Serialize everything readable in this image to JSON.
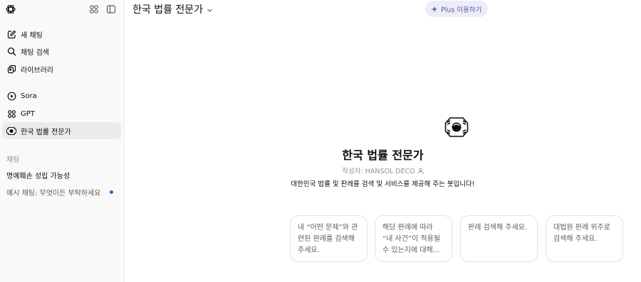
{
  "sidebar": {
    "top_icons": [
      "openai-logo-icon",
      "gpt-grid-icon",
      "sidebar-toggle-icon"
    ],
    "nav": [
      {
        "label": "새 채팅",
        "icon": "edit-icon"
      },
      {
        "label": "채팅 검색",
        "icon": "search-icon"
      },
      {
        "label": "라이브러리",
        "icon": "library-icon"
      }
    ],
    "gpts": [
      {
        "label": "Sora",
        "icon": "play-circle-icon"
      },
      {
        "label": "GPT",
        "icon": "gpt-grid-icon"
      },
      {
        "label": "한국 법률 전문가",
        "icon": "law-expert-avatar-icon"
      }
    ],
    "section_label": "채팅",
    "chats": [
      {
        "label": "명예훼손 성립 가능성"
      },
      {
        "label": "예시 채팅: 무엇이든 부탁하세요",
        "unread": true
      }
    ]
  },
  "header": {
    "model_title": "한국 법률 전문가",
    "plus_label": "Plus 이용하기"
  },
  "gpt": {
    "name": "한국 법률 전문가",
    "author": "작성자: HANSOL DECO",
    "description": "대한민국 법률 및 판례를 검색 및 서비스를 제공해 주는 봇입니다!"
  },
  "starters": [
    "내 “어떤 문제”와 관련된 판례를 검색해 주세요.",
    "해당 판례에 따라 “내 사건”이 적용될 수 있는지에 대해...",
    "판례 검색해 주세요.",
    "대법원 판례 위주로 검색해 주세요."
  ],
  "colors": {
    "sidebar_bg": "#f9f9f9",
    "active_item_bg": "#ebebeb",
    "plus_bg": "#ececfa",
    "unread_dot": "#0f6fd8"
  }
}
